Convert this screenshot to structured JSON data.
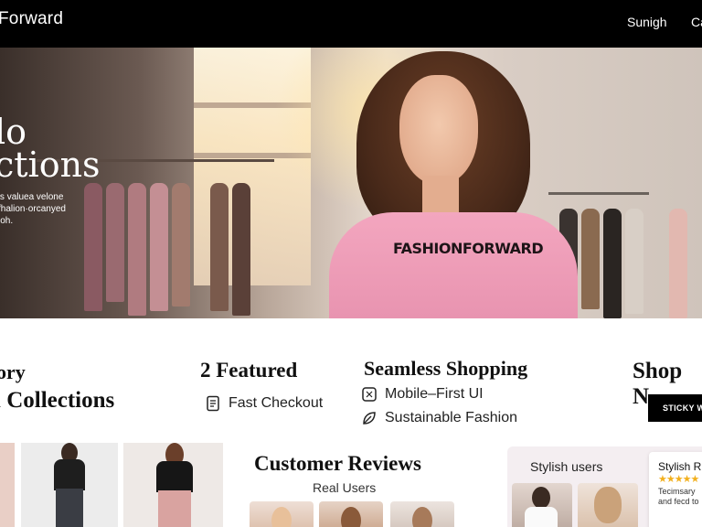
{
  "header": {
    "brand": "Forward",
    "nav": [
      {
        "label": "Sunigh"
      },
      {
        "label": "Ca"
      }
    ]
  },
  "hero": {
    "title_line1": "lo",
    "title_line2": "ctions",
    "subtitle_lines": [
      "'s valuea velone",
      "fhalion·orcanyed",
      "ioh."
    ],
    "shirt_text": "FASHIONFORWARD"
  },
  "features": [
    {
      "title_lines": [
        "ory",
        "l Collections"
      ]
    },
    {
      "title_lines": [
        "2 Featured"
      ],
      "items": [
        {
          "icon": "receipt-icon",
          "label": "Fast Checkout"
        }
      ]
    },
    {
      "title_lines": [
        "Seamless Shopping"
      ],
      "items": [
        {
          "icon": "mobile-icon",
          "label": "Mobile–First UI"
        },
        {
          "icon": "leaf-icon",
          "label": "Sustainable Fashion"
        }
      ]
    },
    {
      "title_lines": [
        "Shop N"
      ],
      "button": "STICKY W"
    }
  ],
  "reviews": {
    "title": "Customer Reviews",
    "subtitle": "Real Users"
  },
  "stylish": {
    "label": "Stylish users",
    "card": {
      "name": "Stylish R",
      "stars": "★★★★★",
      "text_lines": [
        "Tecimsary",
        "and fecd to"
      ]
    }
  },
  "colors": {
    "topbar": "#000000",
    "accent_pink": "#e690ad",
    "star": "#f2b01e",
    "panel": "#f4eef1"
  }
}
